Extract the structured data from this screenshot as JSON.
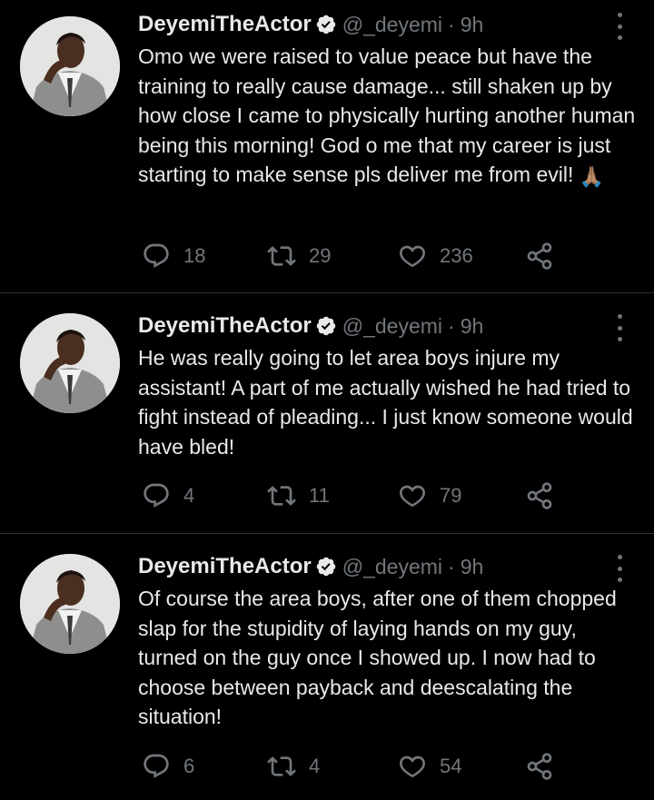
{
  "tweets": [
    {
      "name": "DeyemiTheActor",
      "handle": "@_deyemi",
      "separator": "·",
      "time": "9h",
      "text": "Omo we were raised to value peace but have the training to really cause damage... still shaken up by how close I came to physically hurting another human being this morning! God o me that my career is just starting to make sense pls deliver me from evil!",
      "emoji": "🙏🏽",
      "replies": "18",
      "retweets": "29",
      "likes": "236"
    },
    {
      "name": "DeyemiTheActor",
      "handle": "@_deyemi",
      "separator": "·",
      "time": "9h",
      "text": "He was really going to let area boys injure my assistant!  A part of me actually wished he had tried to fight instead of pleading... I just know someone would have bled!",
      "emoji": "",
      "replies": "4",
      "retweets": "11",
      "likes": "79"
    },
    {
      "name": "DeyemiTheActor",
      "handle": "@_deyemi",
      "separator": "·",
      "time": "9h",
      "text": "Of course the area boys, after one of them chopped slap for the stupidity of laying hands on my guy, turned on the guy once I showed up. I now had to choose between payback and deescalating the situation!",
      "emoji": "",
      "replies": "6",
      "retweets": "4",
      "likes": "54"
    }
  ],
  "colors": {
    "background": "#000000",
    "text": "#e7e9ea",
    "muted": "#71767b",
    "divider": "#2f3336",
    "verified": "#e7e9ea"
  },
  "icons": {
    "reply": "reply-icon",
    "retweet": "retweet-icon",
    "like": "heart-icon",
    "share": "share-icon",
    "verified": "verified-badge-icon",
    "more": "more-icon"
  }
}
